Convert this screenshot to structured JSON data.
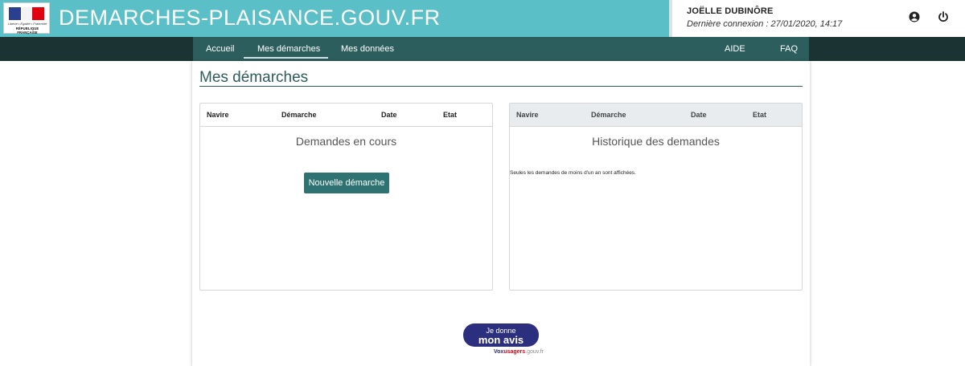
{
  "header": {
    "logo_motto": "Liberté • Égalité • Fraternité",
    "logo_republic": "RÉPUBLIQUE FRANÇAISE",
    "site_title": "DEMARCHES-PLAISANCE.GOUV.FR",
    "user_name": "JOËLLE DUBINÔRE",
    "last_login": "Dernière connexion : 27/01/2020, 14:17",
    "icons": {
      "profile": "user-circle-icon",
      "logout": "power-icon"
    },
    "colors": {
      "topbar": "#5bbfc8",
      "nav_dark": "#1b3332",
      "nav": "#2d5e5e"
    }
  },
  "nav": {
    "items": [
      {
        "label": "Accueil",
        "active": false
      },
      {
        "label": "Mes démarches",
        "active": true
      },
      {
        "label": "Mes données",
        "active": false
      }
    ],
    "right": [
      {
        "label": "AIDE"
      },
      {
        "label": "FAQ"
      }
    ]
  },
  "main": {
    "title": "Mes démarches",
    "current": {
      "columns": [
        "Navire",
        "Démarche",
        "Date",
        "Etat"
      ],
      "caption": "Demandes en cours",
      "button": "Nouvelle démarche"
    },
    "history": {
      "columns": [
        "Navire",
        "Démarche",
        "Date",
        "Etat"
      ],
      "caption": "Historique des demandes",
      "note": "Seules les demandes de moins d'un an sont affichées."
    }
  },
  "feedback": {
    "line1": "Je donne",
    "line2": "mon avis",
    "brand_a": "Vox",
    "brand_b": "usagers",
    "brand_c": ".gouv.fr"
  }
}
